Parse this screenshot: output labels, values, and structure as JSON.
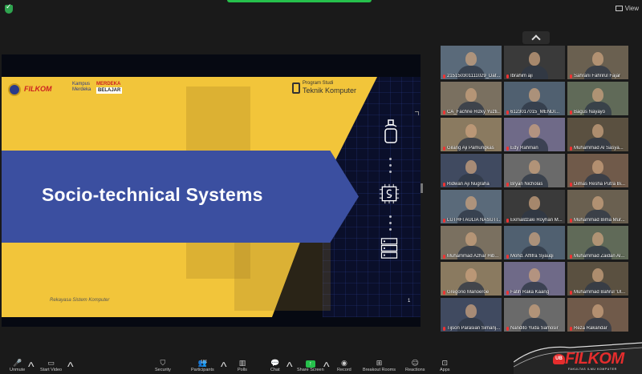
{
  "window": {
    "view_label": "View"
  },
  "slide": {
    "title": "Socio-technical Systems",
    "logos": {
      "filkom": "FILKOM",
      "kampus_merdeka": "Kampus Merdeka",
      "merdeka": "MERDEKA",
      "belajar": "BELAJAR",
      "program_studi": "Program Studi",
      "teknik_komputer": "Teknik Komputer"
    },
    "footer": "Rekayasa Sistem Komputer",
    "page_number": "1"
  },
  "gallery": {
    "participants": [
      "215150301111029_Daf...",
      "Ibrahim aji",
      "Sahrani Fahrirul Fajar",
      "CA_Fachrie Rizky Yuzti...",
      "6123017015_MENDI...",
      "Bagus Nayayo",
      "Gilang Aji Pamungkas",
      "Edy Rahman",
      "Muhammad Al Sasya...",
      "Ridwan Aji Nugraha",
      "Bryan Nicholas",
      "Dimas Resha Putra Bi...",
      "LUTHFI AULIA NASUTI...",
      "Ekmaldzaki Royhan M...",
      "Muhammad Bima Mur...",
      "Muhammad Azhar Hib...",
      "Mohd. Affifra Syauqi",
      "Muhammad Zaidan Al...",
      "Gregorio Manoeroe",
      "Fatih Raka Kaang",
      "Muhammad Bahrul 'Ul...",
      "Tijson Parasian Simanj...",
      "Nandito Yuda Samosir",
      "Reza Rakandar"
    ]
  },
  "toolbar": {
    "unmute": "Unmute",
    "start_video": "Start Video",
    "security": "Security",
    "participants": "Participants",
    "participants_count": "101",
    "polls": "Polls",
    "chat": "Chat",
    "share_screen": "Share Screen",
    "record": "Record",
    "breakout_rooms": "Breakout Rooms",
    "reactions": "Reactions",
    "apps": "Apps"
  },
  "watermark": {
    "ub": "UB",
    "name": "FILKOM",
    "sub": "FAKULTAS ILMU KOMPUTER"
  },
  "colors": {
    "slide_yellow": "#f2c53a",
    "slide_blue": "#3b4fa0",
    "zoom_green": "#26c04c",
    "filkom_red": "#e52d2d"
  }
}
